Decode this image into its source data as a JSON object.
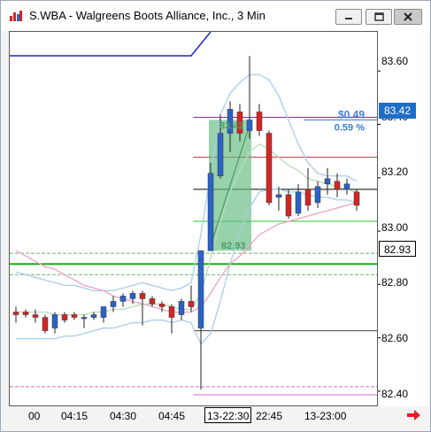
{
  "window": {
    "title": "S.WBA - Walgreens Boots Alliance, Inc., 3 Min",
    "icon": "chart-app-icon",
    "buttons": [
      "minimize-icon",
      "maximize-icon",
      "close-icon"
    ]
  },
  "colors": {
    "up_candle": "#2a63c8",
    "down_candle": "#d42525",
    "bollinger": "#a9cdea",
    "pink_ma": "#f0a0c8",
    "green_ma": "#b8dcb8",
    "selection": "#5fba7d",
    "change_text": "#3a7fd8",
    "current_price_box": "#1e6ec8"
  },
  "price_axis": {
    "labels": [
      "83.60",
      "83.40",
      "83.20",
      "83.00",
      "82.80",
      "82.60",
      "82.40"
    ],
    "current_price": "83.42",
    "last_price": "82.93"
  },
  "time_axis": {
    "labels": [
      "00",
      "04:15",
      "04:30",
      "04:45",
      "22:45",
      "13-23:00"
    ],
    "boxed_label": "13-22:30"
  },
  "measure": {
    "change_value": "$0.49",
    "change_percent": "0.59 %",
    "top_price": "83.42",
    "bottom_price": "82.93"
  },
  "chart_data": {
    "type": "candlestick",
    "ylim": [
      82.35,
      83.75
    ],
    "candles": [
      {
        "o": 82.7,
        "h": 82.72,
        "l": 82.66,
        "c": 82.69
      },
      {
        "o": 82.7,
        "h": 82.71,
        "l": 82.68,
        "c": 82.69
      },
      {
        "o": 82.69,
        "h": 82.71,
        "l": 82.66,
        "c": 82.68
      },
      {
        "o": 82.68,
        "h": 82.69,
        "l": 82.62,
        "c": 82.63
      },
      {
        "o": 82.64,
        "h": 82.7,
        "l": 82.62,
        "c": 82.69
      },
      {
        "o": 82.69,
        "h": 82.7,
        "l": 82.66,
        "c": 82.67
      },
      {
        "o": 82.69,
        "h": 82.7,
        "l": 82.67,
        "c": 82.68
      },
      {
        "o": 82.68,
        "h": 82.69,
        "l": 82.64,
        "c": 82.68
      },
      {
        "o": 82.68,
        "h": 82.7,
        "l": 82.67,
        "c": 82.69
      },
      {
        "o": 82.68,
        "h": 82.72,
        "l": 82.66,
        "c": 82.72
      },
      {
        "o": 82.72,
        "h": 82.76,
        "l": 82.7,
        "c": 82.74
      },
      {
        "o": 82.74,
        "h": 82.77,
        "l": 82.72,
        "c": 82.76
      },
      {
        "o": 82.75,
        "h": 82.78,
        "l": 82.73,
        "c": 82.77
      },
      {
        "o": 82.77,
        "h": 82.78,
        "l": 82.65,
        "c": 82.75
      },
      {
        "o": 82.75,
        "h": 82.76,
        "l": 82.72,
        "c": 82.73
      },
      {
        "o": 82.73,
        "h": 82.74,
        "l": 82.7,
        "c": 82.72
      },
      {
        "o": 82.72,
        "h": 82.73,
        "l": 82.62,
        "c": 82.68
      },
      {
        "o": 82.69,
        "h": 82.75,
        "l": 82.67,
        "c": 82.74
      },
      {
        "o": 82.74,
        "h": 82.8,
        "l": 82.7,
        "c": 82.72
      },
      {
        "o": 82.64,
        "h": 82.93,
        "l": 82.41,
        "c": 82.93
      },
      {
        "o": 82.93,
        "h": 83.26,
        "l": 82.93,
        "c": 83.22
      },
      {
        "o": 83.21,
        "h": 83.44,
        "l": 83.2,
        "c": 83.37
      },
      {
        "o": 83.37,
        "h": 83.49,
        "l": 83.3,
        "c": 83.46
      },
      {
        "o": 83.45,
        "h": 83.48,
        "l": 83.34,
        "c": 83.37
      },
      {
        "o": 83.38,
        "h": 83.66,
        "l": 83.35,
        "c": 83.42
      },
      {
        "o": 83.45,
        "h": 83.48,
        "l": 83.36,
        "c": 83.38
      },
      {
        "o": 83.37,
        "h": 83.38,
        "l": 83.1,
        "c": 83.11
      },
      {
        "o": 83.13,
        "h": 83.17,
        "l": 83.08,
        "c": 83.14
      },
      {
        "o": 83.14,
        "h": 83.16,
        "l": 83.05,
        "c": 83.06
      },
      {
        "o": 83.07,
        "h": 83.18,
        "l": 83.06,
        "c": 83.15
      },
      {
        "o": 83.16,
        "h": 83.24,
        "l": 83.08,
        "c": 83.1
      },
      {
        "o": 83.11,
        "h": 83.19,
        "l": 83.09,
        "c": 83.17
      },
      {
        "o": 83.18,
        "h": 83.24,
        "l": 83.14,
        "c": 83.2
      },
      {
        "o": 83.19,
        "h": 83.22,
        "l": 83.13,
        "c": 83.16
      },
      {
        "o": 83.16,
        "h": 83.2,
        "l": 83.14,
        "c": 83.18
      },
      {
        "o": 83.15,
        "h": 83.16,
        "l": 83.08,
        "c": 83.1
      }
    ],
    "horizontal_lines": [
      {
        "price": 83.43,
        "color": "#8a2a8a",
        "from": 0.5
      },
      {
        "price": 83.42,
        "color": "#3a7fd8",
        "from": 0.8
      },
      {
        "price": 83.28,
        "color": "#c83232",
        "from": 0.5
      },
      {
        "price": 83.16,
        "color": "#000000",
        "from": 0.5
      },
      {
        "price": 83.04,
        "color": "#2ec82e",
        "from": 0.5
      },
      {
        "price": 82.92,
        "color": "#6ab46a",
        "from": 0,
        "dash": true
      },
      {
        "price": 82.88,
        "color": "#10b410",
        "from": 0,
        "thick": true
      },
      {
        "price": 82.84,
        "color": "#6ab46a",
        "from": 0,
        "dash": true
      },
      {
        "price": 82.63,
        "color": "#404040",
        "from": 0.5
      },
      {
        "price": 82.42,
        "color": "#d070c0",
        "from": 0,
        "dash": true
      },
      {
        "price": 82.39,
        "color": "#e060d0",
        "from": 0.5
      }
    ],
    "bollinger_upper": [
      82.85,
      82.84,
      82.83,
      82.82,
      82.81,
      82.8,
      82.8,
      82.79,
      82.78,
      82.78,
      82.78,
      82.79,
      82.8,
      82.81,
      82.8,
      82.79,
      82.78,
      82.79,
      82.81,
      82.99,
      83.22,
      83.44,
      83.52,
      83.56,
      83.59,
      83.59,
      83.57,
      83.51,
      83.42,
      83.33,
      83.26,
      83.22,
      83.21,
      83.21,
      83.21,
      83.19
    ],
    "bollinger_lower": [
      82.6,
      82.6,
      82.6,
      82.6,
      82.6,
      82.61,
      82.61,
      82.62,
      82.63,
      82.64,
      82.64,
      82.65,
      82.66,
      82.66,
      82.67,
      82.67,
      82.66,
      82.67,
      82.66,
      82.58,
      82.62,
      82.74,
      82.88,
      83.0,
      83.09,
      83.15,
      83.16,
      83.16,
      83.15,
      83.15,
      83.14,
      83.13,
      83.13,
      83.12,
      83.12,
      83.11
    ],
    "pink_ma": [
      82.93,
      82.91,
      82.89,
      82.87,
      82.86,
      82.84,
      82.82,
      82.8,
      82.79,
      82.78,
      82.76,
      82.75,
      82.74,
      82.73,
      82.72,
      82.71,
      82.7,
      82.7,
      82.7,
      82.72,
      82.77,
      82.83,
      82.88,
      82.91,
      82.95,
      82.99,
      83.01,
      83.03,
      83.04,
      83.05,
      83.06,
      83.07,
      83.08,
      83.09,
      83.1,
      83.11
    ],
    "green_ma": [
      82.7,
      82.7,
      82.7,
      82.7,
      82.69,
      82.69,
      82.69,
      82.69,
      82.7,
      82.7,
      82.71,
      82.71,
      82.72,
      82.73,
      82.73,
      82.73,
      82.72,
      82.71,
      82.71,
      82.77,
      82.9,
      83.04,
      83.15,
      83.23,
      83.3,
      83.33,
      83.31,
      83.28,
      83.25,
      83.23,
      83.2,
      83.19,
      83.18,
      83.17,
      83.16,
      83.15
    ],
    "selection": {
      "from_index": 20,
      "to_index": 24,
      "low": 82.93,
      "high": 83.42
    }
  }
}
